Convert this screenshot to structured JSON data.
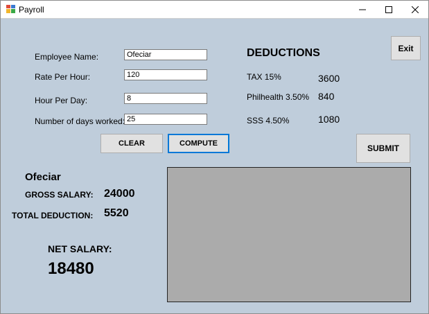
{
  "window": {
    "title": "Payroll",
    "min_icon": "minimize-icon",
    "max_icon": "maximize-icon",
    "close_icon": "close-icon"
  },
  "form": {
    "employee_name_label": "Employee Name:",
    "employee_name_value": "Ofeciar",
    "rate_label": "Rate Per Hour:",
    "rate_value": "120",
    "hours_label": "Hour Per Day:",
    "hours_value": "8",
    "days_label": "Number of days worked:",
    "days_value": "25"
  },
  "buttons": {
    "clear": "CLEAR",
    "compute": "COMPUTE",
    "exit": "Exit",
    "submit": "SUBMIT"
  },
  "deductions": {
    "title": "DEDUCTIONS",
    "tax_label": "TAX 15%",
    "tax_value": "3600",
    "philhealth_label": "Philhealth 3.50%",
    "philhealth_value": "840",
    "sss_label": "SSS 4.50%",
    "sss_value": "1080"
  },
  "summary": {
    "name": "Ofeciar",
    "gross_label": "GROSS SALARY:",
    "gross_value": "24000",
    "total_deduction_label": "TOTAL DEDUCTION:",
    "total_deduction_value": "5520",
    "net_label": "NET SALARY:",
    "net_value": "18480"
  },
  "colors": {
    "form_bg": "#bfcddb",
    "panel_bg": "#ababab",
    "focus": "#0078d7"
  }
}
